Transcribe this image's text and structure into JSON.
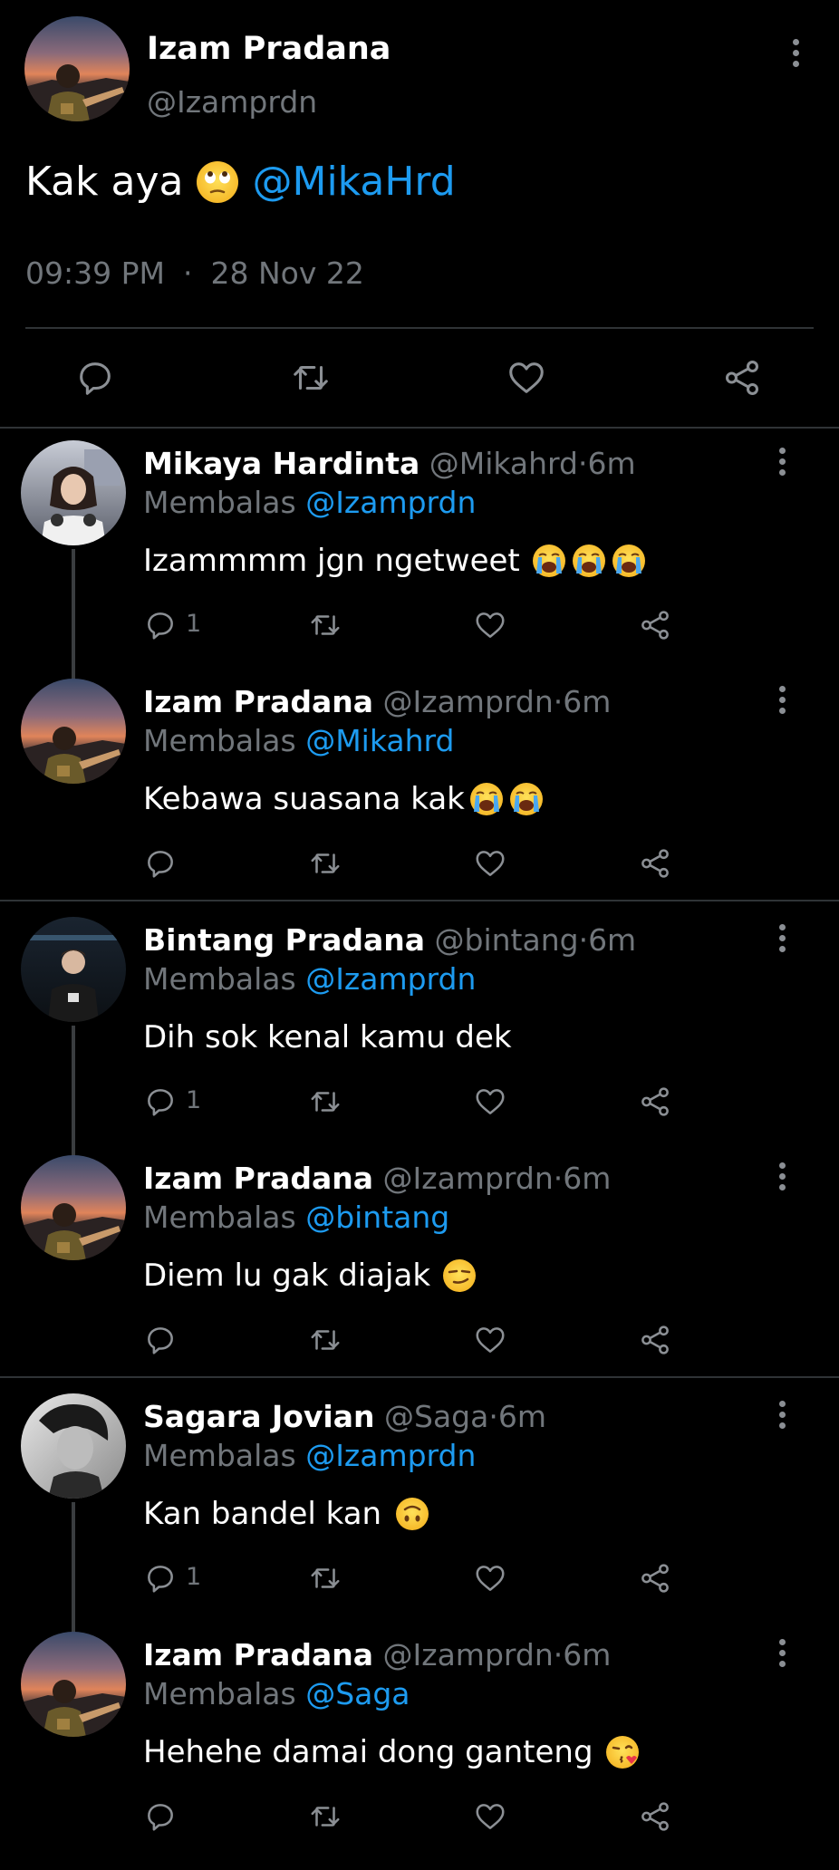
{
  "main_tweet": {
    "author_name": "Izam Pradana",
    "author_handle": "@Izamprdn",
    "text": "Kak aya",
    "emoji": "face-with-rolling-eyes-emoji",
    "mention": "@MikaHrd",
    "time": "09:39 PM",
    "separator": "·",
    "date": "28 Nov 22",
    "actions": [
      "reply-icon",
      "retweet-icon",
      "like-icon",
      "share-icon"
    ]
  },
  "replies": [
    {
      "author_name": "Mikaya Hardinta",
      "author_handle": "@Mikahrd",
      "dot": "·",
      "time_ago": "6m",
      "replying_prefix": "Membalas",
      "replying_to": "@Izamprdn",
      "text": "Izammmm jgn ngetweet",
      "emojis": [
        "loudly-crying-face-emoji",
        "loudly-crying-face-emoji",
        "loudly-crying-face-emoji"
      ],
      "reply_count": "1"
    },
    {
      "author_name": "Izam Pradana",
      "author_handle": "@Izamprdn",
      "dot": "·",
      "time_ago": "6m",
      "replying_prefix": "Membalas",
      "replying_to": "@Mikahrd",
      "text": "Kebawa suasana kak",
      "emojis": [
        "loudly-crying-face-emoji",
        "loudly-crying-face-emoji"
      ],
      "reply_count": ""
    },
    {
      "author_name": "Bintang Pradana",
      "author_handle": "@bintang",
      "dot": "·",
      "time_ago": "6m",
      "replying_prefix": "Membalas",
      "replying_to": "@Izamprdn",
      "text": "Dih sok kenal kamu dek",
      "emojis": [],
      "reply_count": "1"
    },
    {
      "author_name": "Izam Pradana",
      "author_handle": "@Izamprdn",
      "dot": "·",
      "time_ago": "6m",
      "replying_prefix": "Membalas",
      "replying_to": "@bintang",
      "text": "Diem lu gak diajak",
      "emojis": [
        "smirking-face-emoji"
      ],
      "reply_count": ""
    },
    {
      "author_name": "Sagara Jovian",
      "author_handle": "@Saga",
      "dot": "·",
      "time_ago": "6m",
      "replying_prefix": "Membalas",
      "replying_to": "@Izamprdn",
      "text": "Kan bandel kan",
      "emojis": [
        "upside-down-face-emoji"
      ],
      "reply_count": "1"
    },
    {
      "author_name": "Izam Pradana",
      "author_handle": "@Izamprdn",
      "dot": "·",
      "time_ago": "6m",
      "replying_prefix": "Membalas",
      "replying_to": "@Saga",
      "text": "Hehehe damai dong ganteng",
      "emojis": [
        "face-blowing-a-kiss-emoji"
      ],
      "reply_count": ""
    }
  ],
  "colors": {
    "background": "#000000",
    "text_primary": "#ffffff",
    "text_secondary": "#71767b",
    "accent": "#1d9bf0",
    "divider": "#2f3336"
  }
}
